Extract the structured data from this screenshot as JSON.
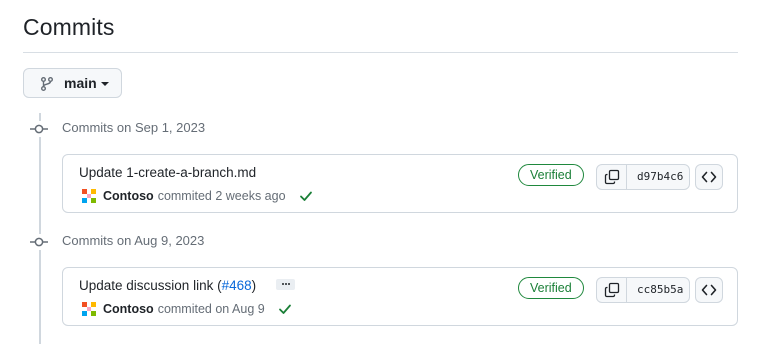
{
  "page": {
    "title": "Commits"
  },
  "branch": {
    "name": "main",
    "icon": "git-branch-icon"
  },
  "colors": {
    "accent_link": "#0969da",
    "verified_green": "#1a7f37",
    "border": "#d0d7de",
    "muted_text": "#656d76"
  },
  "commit_groups": [
    {
      "title": "Commits on Sep 1, 2023",
      "commits": [
        {
          "message": "Update 1-create-a-branch.md",
          "pr_link": "",
          "author": "Contoso",
          "time": "commited 2 weeks ago",
          "status_icon": "check-icon",
          "verified_label": "Verified",
          "sha": "d97b4c6"
        }
      ]
    },
    {
      "title": "Commits on Aug 9, 2023",
      "commits": [
        {
          "message": "Update discussion link (",
          "pr_link": "#468",
          "message_suffix": ")",
          "author": "Contoso",
          "time": "commited on Aug 9",
          "status_icon": "check-icon",
          "verified_label": "Verified",
          "sha": "cc85b5a"
        }
      ]
    }
  ]
}
